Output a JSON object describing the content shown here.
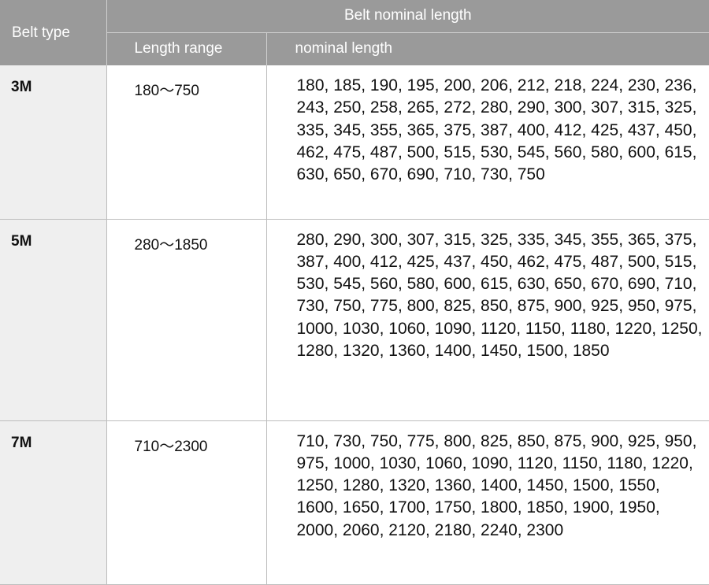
{
  "header": {
    "belt_type": "Belt type",
    "group": "Belt nominal length",
    "length_range": "Length range",
    "nominal_length": "nominal  length"
  },
  "rows": [
    {
      "type": "3M",
      "range": "180～750",
      "lengths": "180, 185, 190, 195, 200, 206, 212, 218, 224, 230, 236, 243, 250, 258, 265, 272, 280, 290, 300, 307, 315, 325, 335, 345, 355, 365, 375, 387, 400, 412, 425, 437, 450, 462, 475, 487, 500, 515, 530, 545, 560, 580, 600, 615, 630, 650, 670, 690, 710, 730, 750"
    },
    {
      "type": "5M",
      "range": "280～1850",
      "lengths": "280, 290, 300, 307, 315, 325, 335, 345, 355, 365, 375, 387, 400, 412, 425, 437, 450, 462, 475, 487, 500, 515, 530, 545, 560, 580, 600, 615, 630, 650, 670, 690, 710, 730, 750, 775, 800, 825, 850, 875, 900, 925, 950, 975, 1000, 1030, 1060, 1090, 1120, 1150, 1180, 1220, 1250, 1280, 1320, 1360, 1400, 1450, 1500, 1850"
    },
    {
      "type": "7M",
      "range": "710～2300",
      "lengths": "710, 730, 750, 775, 800, 825, 850, 875, 900, 925, 950, 975, 1000, 1030, 1060, 1090, 1120, 1150, 1180, 1220, 1250, 1280, 1320, 1360, 1400, 1450, 1500, 1550, 1600, 1650, 1700, 1750, 1800, 1850, 1900, 1950, 2000, 2060, 2120, 2180, 2240, 2300"
    }
  ],
  "colors": {
    "header_bg": "#9a9a9a",
    "type_column_bg": "#efefef",
    "border": "#bdbdbd"
  }
}
